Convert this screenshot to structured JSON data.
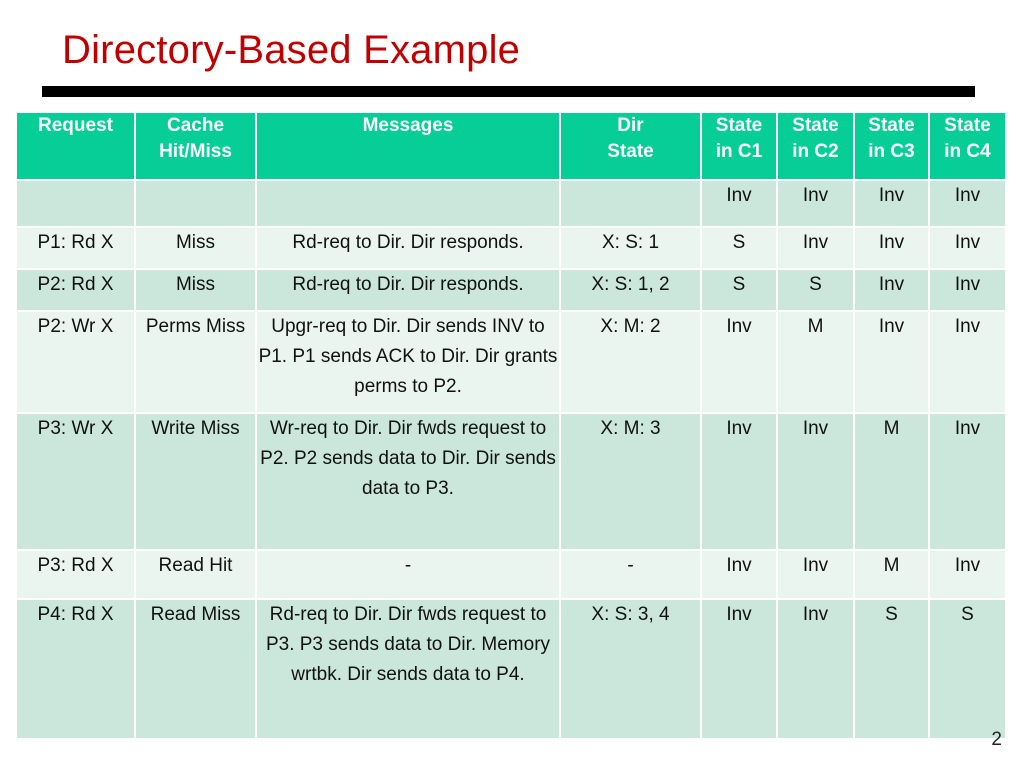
{
  "slide": {
    "title": "Directory-Based Example",
    "page_number": "2",
    "accent_color": "#C00000",
    "header_color": "#06CE96",
    "row_light_color": "#EBF5F0",
    "row_dark_color": "#CBE7DC"
  },
  "table": {
    "columns": [
      {
        "key": "request",
        "label_lines": [
          "Request"
        ]
      },
      {
        "key": "cache",
        "label_lines": [
          "Cache",
          "Hit/Miss"
        ]
      },
      {
        "key": "messages",
        "label_lines": [
          "Messages"
        ]
      },
      {
        "key": "dir",
        "label_lines": [
          "Dir",
          "State"
        ]
      },
      {
        "key": "c1",
        "label_lines": [
          "State",
          "in C1"
        ]
      },
      {
        "key": "c2",
        "label_lines": [
          "State",
          "in C2"
        ]
      },
      {
        "key": "c3",
        "label_lines": [
          "State",
          "in C3"
        ]
      },
      {
        "key": "c4",
        "label_lines": [
          "State",
          "in C4"
        ]
      }
    ],
    "rows": [
      {
        "request": "",
        "cache": "",
        "messages": "",
        "dir": "",
        "c1": "Inv",
        "c2": "Inv",
        "c3": "Inv",
        "c4": "Inv"
      },
      {
        "request": "P1: Rd X",
        "cache": "Miss",
        "messages": "Rd-req to Dir. Dir responds.",
        "dir": "X: S: 1",
        "c1": "S",
        "c2": "Inv",
        "c3": "Inv",
        "c4": "Inv"
      },
      {
        "request": "P2: Rd X",
        "cache": "Miss",
        "messages": "Rd-req to Dir. Dir responds.",
        "dir": "X: S: 1, 2",
        "c1": "S",
        "c2": "S",
        "c3": "Inv",
        "c4": "Inv"
      },
      {
        "request": "P2: Wr X",
        "cache": "Perms Miss",
        "messages": "Upgr-req to Dir. Dir sends INV to P1. P1 sends ACK to Dir. Dir grants perms to P2.",
        "dir": "X: M: 2",
        "c1": "Inv",
        "c2": "M",
        "c3": "Inv",
        "c4": "Inv"
      },
      {
        "request": "P3: Wr X",
        "cache": "Write Miss",
        "messages": "Wr-req to Dir. Dir fwds request to P2. P2 sends data to Dir. Dir sends data to P3.",
        "dir": "X: M: 3",
        "c1": "Inv",
        "c2": "Inv",
        "c3": "M",
        "c4": "Inv"
      },
      {
        "request": "P3: Rd X",
        "cache": "Read Hit",
        "messages": "-",
        "dir": "-",
        "c1": "Inv",
        "c2": "Inv",
        "c3": "M",
        "c4": "Inv"
      },
      {
        "request": "P4: Rd X",
        "cache": "Read Miss",
        "messages": "Rd-req to Dir. Dir fwds request to P3. P3 sends data to Dir. Memory wrtbk. Dir sends data to P4.",
        "dir": "X: S: 3, 4",
        "c1": "Inv",
        "c2": "Inv",
        "c3": "S",
        "c4": "S"
      }
    ]
  }
}
